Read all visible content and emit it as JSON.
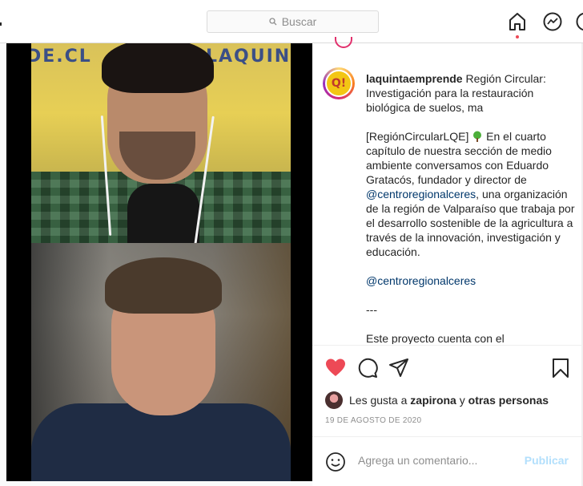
{
  "header": {
    "search_placeholder": "Buscar",
    "icons": [
      "search-icon",
      "home-icon",
      "messenger-icon"
    ],
    "accent": "#ed4956"
  },
  "video": {
    "wall_sign_left": "LAQUINT",
    "wall_sign_right": "DE.CL"
  },
  "post": {
    "username": "laquintaemprende",
    "avatar_text": "Q!",
    "caption_title": "Región Circular: Investigación para la restauración biológica de suelos, ma",
    "caption_tag": "[RegiónCircularLQE]",
    "caption_body": "En el cuarto capítulo de nuestra sección de medio ambiente conversamos con Eduardo Gratacós, fundador y director de",
    "mention_1": "@centroregionalceres",
    "caption_body_2": ", una organización de la región de Valparaíso que trabaja por el desarrollo sostenible de la agricultura a través de la innovación, investigación y educación.",
    "mention_2": "@centroregionalceres",
    "divider": "---",
    "caption_tail": "Este proyecto cuenta con el",
    "likes_prefix": "Les gusta a",
    "likes_user": "zapirona",
    "likes_and": "y",
    "likes_others": "otras personas",
    "date": "19 DE AGOSTO DE 2020",
    "comment_placeholder": "Agrega un comentario...",
    "publish_label": "Publicar",
    "colors": {
      "heart": "#ed4956",
      "mention": "#00376b",
      "publish_disabled": "#b2dffc",
      "muted": "#8e8e8e"
    }
  }
}
